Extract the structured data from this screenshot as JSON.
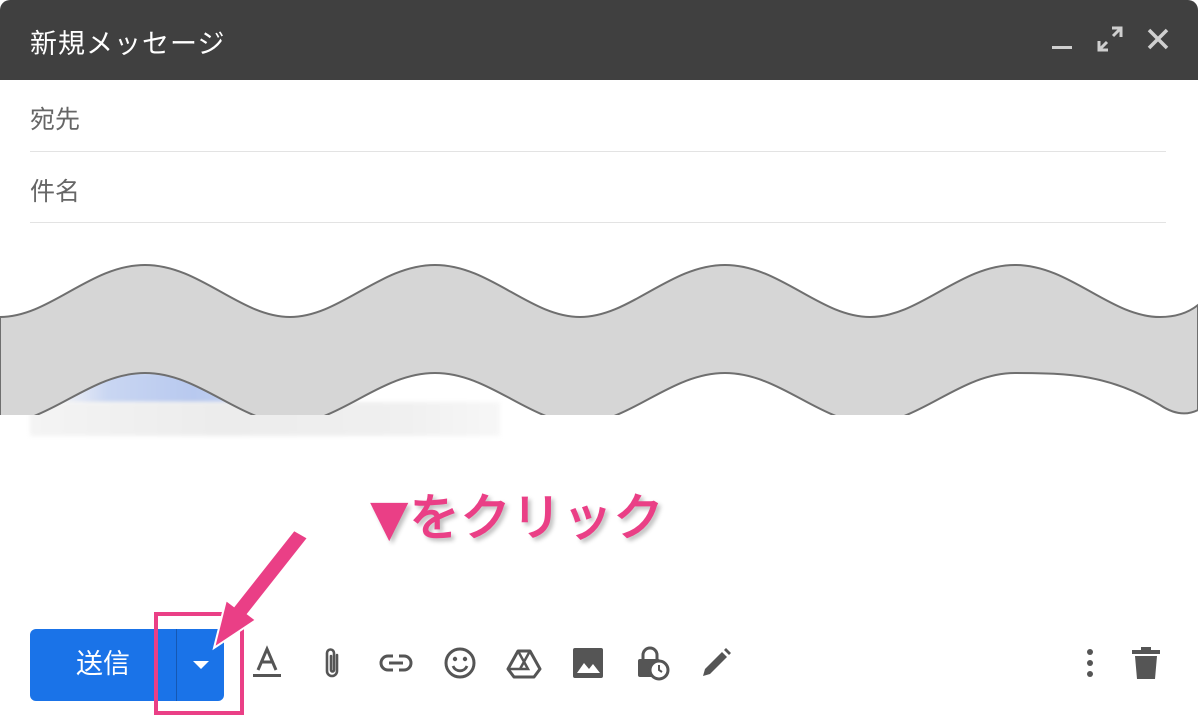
{
  "window": {
    "title": "新規メッセージ",
    "controls": [
      "minimize-icon",
      "expand-icon",
      "close-icon"
    ]
  },
  "fields": {
    "to_label": "宛先",
    "subject_label": "件名"
  },
  "annotation": {
    "text": "▼をクリック",
    "color": "#ea3f86"
  },
  "toolbar": {
    "send_label": "送信",
    "send_color": "#1a73e8",
    "icons": [
      "format-text-icon",
      "attach-icon",
      "link-icon",
      "emoji-icon",
      "drive-icon",
      "photo-icon",
      "confidential-mode-icon",
      "signature-icon",
      "more-options-icon",
      "trash-icon"
    ]
  }
}
